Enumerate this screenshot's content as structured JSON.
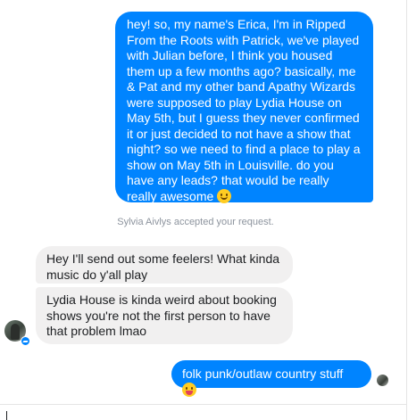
{
  "conversation": {
    "messages": [
      {
        "direction": "outgoing",
        "text": "hey! so, my name's Erica, I'm in Ripped From the Roots with Patrick, we've played with Julian before, I think you housed them up a few months ago? basically, me & Pat and my other band Apathy Wizards were supposed to play Lydia House on May 5th, but I guess they never confirmed it or just decided to not have a show that night? so we need to find a place to play a show on May 5th in Louisville. do you have any leads? that would be really really awesome",
        "emoji": "slightly-smiling-face-icon"
      },
      {
        "direction": "incoming",
        "text": "Hey I'll send out some feelers! What kinda music do y'all play"
      },
      {
        "direction": "incoming",
        "text": "Lydia House is kinda weird about booking shows you're not the first person to have that problem lmao"
      },
      {
        "direction": "outgoing",
        "text": "folk punk/outlaw country stuff",
        "emoji": "tongue-out-face-icon"
      }
    ],
    "system_note": "Sylvia Aivlys accepted your request."
  },
  "colors": {
    "outgoing_bubble": "#0084ff",
    "incoming_bubble": "#f1f0f0",
    "system_text": "#8d949e"
  }
}
